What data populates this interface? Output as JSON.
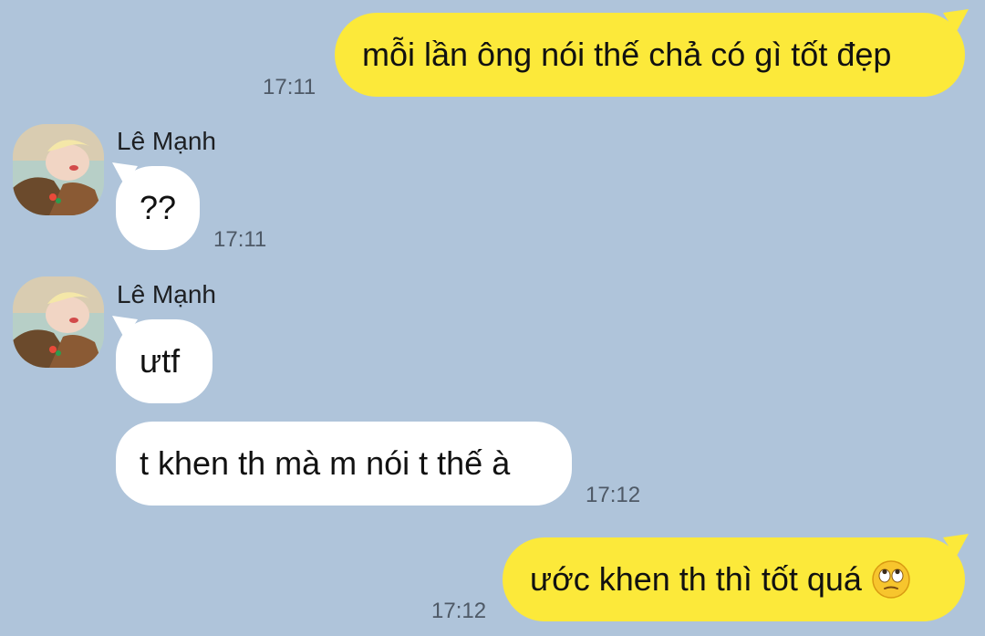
{
  "messages": [
    {
      "direction": "outgoing",
      "text": "mỗi lần ông nói thế chả có gì tốt đẹp",
      "time": "17:11"
    },
    {
      "direction": "incoming",
      "sender": "Lê Mạnh",
      "text": "??",
      "time": "17:11"
    },
    {
      "direction": "incoming",
      "sender": "Lê Mạnh",
      "text": "ưtf"
    },
    {
      "direction": "incoming",
      "text": "t khen th mà m nói t thế à",
      "time": "17:12"
    },
    {
      "direction": "outgoing",
      "text": "ước khen th thì tốt quá",
      "emoji": "face-with-rolling-eyes",
      "time": "17:12"
    }
  ],
  "colors": {
    "background": "#afc4da",
    "outgoing_bubble": "#fce93a",
    "incoming_bubble": "#ffffff",
    "timestamp": "#4e5966"
  }
}
